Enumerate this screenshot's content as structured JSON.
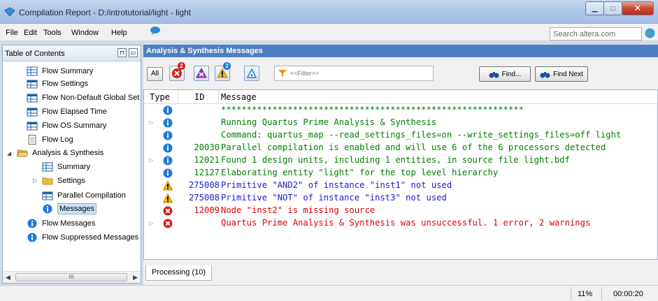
{
  "window": {
    "title": "Compilation Report - D:/introtutorial/light - light"
  },
  "menu": {
    "items": [
      "File",
      "Edit",
      "Tools",
      "Window",
      "Help"
    ],
    "search_placeholder": "Search altera.com"
  },
  "toc": {
    "title": "Table of Contents",
    "items": [
      {
        "label": "Flow Summary"
      },
      {
        "label": "Flow Settings"
      },
      {
        "label": "Flow Non-Default Global Set"
      },
      {
        "label": "Flow Elapsed Time"
      },
      {
        "label": "Flow OS Summary"
      },
      {
        "label": "Flow Log"
      },
      {
        "label": "Analysis & Synthesis"
      },
      {
        "label": "Summary"
      },
      {
        "label": "Settings"
      },
      {
        "label": "Parallel Compilation"
      },
      {
        "label": "Messages"
      },
      {
        "label": "Flow Messages"
      },
      {
        "label": "Flow Suppressed Messages"
      }
    ]
  },
  "messages_panel": {
    "title": "Analysis & Synthesis Messages",
    "all_label": "All",
    "error_count": "2",
    "warning_count": "2",
    "filter_placeholder": "<<Filter>>",
    "find_label": "Find...",
    "find_next_label": "Find Next",
    "columns": [
      "Type",
      "ID",
      "Message"
    ],
    "rows": [
      {
        "type": "info",
        "id": "",
        "message": "***********************************************************",
        "expand": false
      },
      {
        "type": "info",
        "id": "",
        "message": "Running Quartus Prime Analysis & Synthesis",
        "expand": true
      },
      {
        "type": "info",
        "id": "",
        "message": "Command: quartus_map --read_settings_files=on --write_settings_files=off light",
        "expand": false
      },
      {
        "type": "info",
        "id": "20030",
        "message": "Parallel compilation is enabled and will use 6 of the 6 processors detected",
        "expand": false
      },
      {
        "type": "info",
        "id": "12021",
        "message": "Found 1 design units, including 1 entities, in source file light.bdf",
        "expand": true
      },
      {
        "type": "info",
        "id": "12127",
        "message": "Elaborating entity \"light\" for the top level hierarchy",
        "expand": false
      },
      {
        "type": "warning",
        "id": "275008",
        "message": "Primitive \"AND2\" of instance \"inst1\" not used",
        "expand": false
      },
      {
        "type": "warning",
        "id": "275008",
        "message": "Primitive \"NOT\" of instance \"inst3\" not used",
        "expand": false
      },
      {
        "type": "error",
        "id": "12009",
        "message": "Node \"inst2\" is missing source",
        "expand": false
      },
      {
        "type": "error",
        "id": "",
        "message": "Quartus Prime Analysis & Synthesis was unsuccessful. 1 error, 2 warnings",
        "expand": true
      }
    ],
    "tab_label": "Processing (10)"
  },
  "status": {
    "progress": "11%",
    "elapsed": "00:00:20"
  }
}
